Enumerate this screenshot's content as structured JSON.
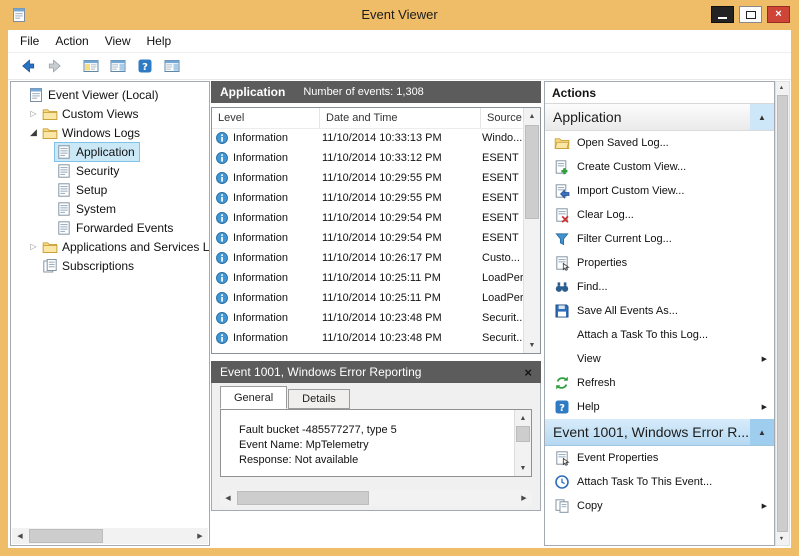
{
  "window": {
    "title": "Event Viewer",
    "icon_name": "event-viewer-app",
    "close_glyph": "×",
    "controls": [
      "minimize",
      "maximize",
      "close"
    ]
  },
  "menubar": {
    "items": [
      "File",
      "Action",
      "View",
      "Help"
    ]
  },
  "toolbar": {
    "buttons": [
      {
        "name": "back",
        "icon": "back-arrow"
      },
      {
        "name": "forward",
        "icon": "forward-arrow"
      },
      {
        "name": "show-console-tree",
        "icon": "console-tree"
      },
      {
        "name": "show-action-pane",
        "icon": "action-pane"
      },
      {
        "name": "help",
        "icon": "help"
      },
      {
        "name": "show-action-pane-2",
        "icon": "action-pane"
      }
    ]
  },
  "tree": {
    "items": [
      {
        "label": "Event Viewer (Local)",
        "indent": 0,
        "icon": "event-viewer-root",
        "expand": "none",
        "selected": false
      },
      {
        "label": "Custom Views",
        "indent": 1,
        "icon": "folder",
        "expand": "collapsed",
        "selected": false
      },
      {
        "label": "Windows Logs",
        "indent": 1,
        "icon": "folder",
        "expand": "expanded",
        "selected": false
      },
      {
        "label": "Application",
        "indent": 2,
        "icon": "log",
        "expand": "none",
        "selected": true
      },
      {
        "label": "Security",
        "indent": 2,
        "icon": "log",
        "expand": "none",
        "selected": false
      },
      {
        "label": "Setup",
        "indent": 2,
        "icon": "log",
        "expand": "none",
        "selected": false
      },
      {
        "label": "System",
        "indent": 2,
        "icon": "log",
        "expand": "none",
        "selected": false
      },
      {
        "label": "Forwarded Events",
        "indent": 2,
        "icon": "log",
        "expand": "none",
        "selected": false
      },
      {
        "label": "Applications and Services Lo",
        "indent": 1,
        "icon": "folder",
        "expand": "collapsed",
        "selected": false
      },
      {
        "label": "Subscriptions",
        "indent": 1,
        "icon": "subscriptions",
        "expand": "none",
        "selected": false
      }
    ]
  },
  "events": {
    "title": "Application",
    "subtitle": "Number of events: 1,308",
    "columns": [
      "Level",
      "Date and Time",
      "Source"
    ],
    "rows": [
      {
        "level": "Information",
        "datetime": "11/10/2014 10:33:13 PM",
        "source": "Windo..."
      },
      {
        "level": "Information",
        "datetime": "11/10/2014 10:33:12 PM",
        "source": "ESENT"
      },
      {
        "level": "Information",
        "datetime": "11/10/2014 10:29:55 PM",
        "source": "ESENT"
      },
      {
        "level": "Information",
        "datetime": "11/10/2014 10:29:55 PM",
        "source": "ESENT"
      },
      {
        "level": "Information",
        "datetime": "11/10/2014 10:29:54 PM",
        "source": "ESENT"
      },
      {
        "level": "Information",
        "datetime": "11/10/2014 10:29:54 PM",
        "source": "ESENT"
      },
      {
        "level": "Information",
        "datetime": "11/10/2014 10:26:17 PM",
        "source": "Custo..."
      },
      {
        "level": "Information",
        "datetime": "11/10/2014 10:25:11 PM",
        "source": "LoadPerf"
      },
      {
        "level": "Information",
        "datetime": "11/10/2014 10:25:11 PM",
        "source": "LoadPerf"
      },
      {
        "level": "Information",
        "datetime": "11/10/2014 10:23:48 PM",
        "source": "Securit..."
      },
      {
        "level": "Information",
        "datetime": "11/10/2014 10:23:48 PM",
        "source": "Securit..."
      }
    ]
  },
  "preview": {
    "title": "Event 1001, Windows Error Reporting",
    "close_glyph": "×",
    "tabs": [
      {
        "label": "General",
        "active": true
      },
      {
        "label": "Details",
        "active": false
      }
    ],
    "content_lines": [
      "Fault bucket -485577277, type 5",
      "Event Name: MpTelemetry",
      "Response: Not available"
    ]
  },
  "actions": {
    "header": "Actions",
    "groups": [
      {
        "title": "Application",
        "highlighted": false,
        "items": [
          {
            "label": "Open Saved Log...",
            "icon": "open-saved-log"
          },
          {
            "label": "Create Custom View...",
            "icon": "create-custom-view"
          },
          {
            "label": "Import Custom View...",
            "icon": "import-custom-view"
          },
          {
            "label": "Clear Log...",
            "icon": "clear-log"
          },
          {
            "label": "Filter Current Log...",
            "icon": "filter"
          },
          {
            "label": "Properties",
            "icon": "properties"
          },
          {
            "label": "Find...",
            "icon": "find"
          },
          {
            "label": "Save All Events As...",
            "icon": "save"
          },
          {
            "label": "Attach a Task To this Log...",
            "icon": "blank"
          },
          {
            "label": "View",
            "icon": "blank",
            "submenu": true
          },
          {
            "label": "Refresh",
            "icon": "refresh"
          },
          {
            "label": "Help",
            "icon": "help",
            "submenu": true
          }
        ]
      },
      {
        "title": "Event 1001, Windows Error R...",
        "highlighted": true,
        "items": [
          {
            "label": "Event Properties",
            "icon": "properties"
          },
          {
            "label": "Attach Task To This Event...",
            "icon": "task"
          },
          {
            "label": "Copy",
            "icon": "copy",
            "submenu": true
          }
        ]
      }
    ]
  }
}
